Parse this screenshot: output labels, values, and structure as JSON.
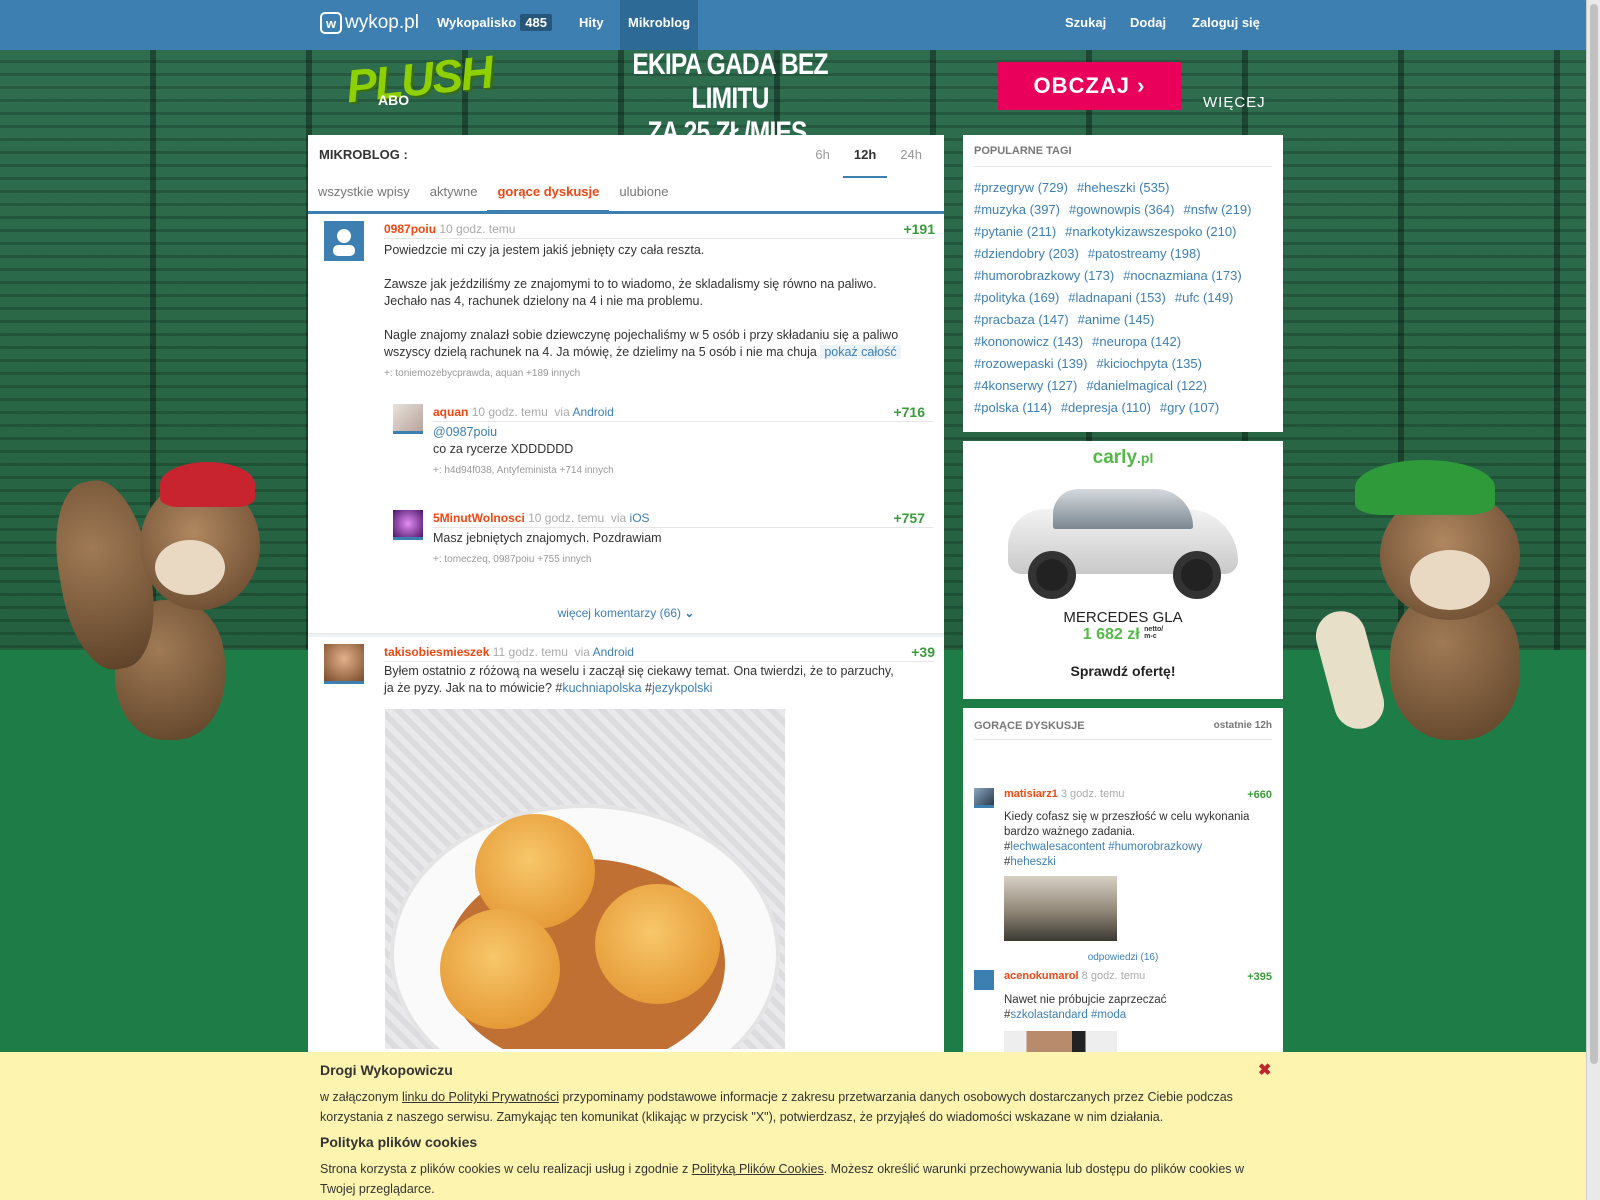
{
  "nav": {
    "logo": "wykop.pl",
    "logo_mark": "w",
    "items": [
      {
        "label": "Wykopalisko",
        "badge": "485"
      },
      {
        "label": "Hity"
      },
      {
        "label": "Mikroblog"
      }
    ],
    "right": [
      "Szukaj",
      "Dodaj",
      "Zaloguj się"
    ]
  },
  "ad": {
    "brand": "PLUSH",
    "brand_sub": "ABO",
    "headline": "EKIPA GADA BEZ LIMITU\nZA 25 ZŁ/MIES.",
    "button": "OBCZAJ  ›",
    "more": "WIĘCEJ"
  },
  "mikroblog": {
    "title": "MIKROBLOG :",
    "periods": [
      "6h",
      "12h",
      "24h"
    ],
    "tabs": [
      "wszystkie wpisy",
      "aktywne",
      "gorące dyskusje",
      "ulubione"
    ]
  },
  "entries": [
    {
      "user": "0987poiu",
      "time": "10 godz. temu",
      "score": "+191",
      "lines": [
        "Powiedzcie mi czy ja jestem jakiś jebnięty czy cała reszta.",
        "Zawsze jak jeździliśmy ze znajomymi to to wiadomo, że skladalismy się równo na paliwo.",
        "Jechało nas 4, rachunek dzielony na 4 i nie ma problemu.",
        "Nagle znajomy znalazł sobie dziewczynę pojechaliśmy w 5 osób i przy składaniu się a paliwo",
        "wszyscy dzielą rachunek na 4. Ja mówię, że dzielimy na 5 osób i nie ma chuja"
      ],
      "show_all": "pokaż całość",
      "plus": "+: toniemozebycprawda, aquan +189 innych"
    }
  ],
  "comments": [
    {
      "user": "aquan",
      "time": "10 godz. temu",
      "via_label": "via",
      "via": "Android",
      "score": "+716",
      "mention": "@0987poiu",
      "text": "co za rycerze XDDDDDD",
      "plus": "+: h4d94f038, Antyfeminista +714 innych"
    },
    {
      "user": "5MinutWolnosci",
      "time": "10 godz. temu",
      "via_label": "via",
      "via": "iOS",
      "score": "+757",
      "text": "Masz jebniętych znajomych. Pozdrawiam",
      "plus": "+: tomeczeq, 0987poiu +755 innych"
    }
  ],
  "more_comments": "więcej komentarzy (66)",
  "entry2": {
    "user": "takisobiesmieszek",
    "time": "11 godz. temu",
    "via_label": "via",
    "via": "Android",
    "score": "+39",
    "line1": "Byłem ostatnio z różową na weselu i zaczął się ciekawy temat. Ona twierdzi, że to parzuchy,",
    "line2_a": "ja że pyzy. Jak na to mówicie? #",
    "tag1": "kuchniapolska",
    "hash": "#",
    "tag2": "jezykpolski"
  },
  "popular_tags": {
    "title": "POPULARNE TAGI",
    "tags": [
      "#przegryw (729)",
      "#heheszki (535)",
      "#muzyka (397)",
      "#gownowpis (364)",
      "#nsfw (219)",
      "#pytanie (211)",
      "#narkotykizawszespoko (210)",
      "#dziendobry (203)",
      "#patostreamy (198)",
      "#humorobrazkowy (173)",
      "#nocnazmiana (173)",
      "#polityka (169)",
      "#ladnapani (153)",
      "#ufc (149)",
      "#pracbaza (147)",
      "#anime (145)",
      "#kononowicz (143)",
      "#neuropa (142)",
      "#rozowepaski (139)",
      "#kiciochpyta (135)",
      "#4konserwy (127)",
      "#danielmagical (122)",
      "#polska (114)",
      "#depresja (110)",
      "#gry (107)"
    ]
  },
  "carly": {
    "brand": "carly",
    "brand_tld": ".pl",
    "model": "MERCEDES GLA",
    "price": "1 682 zł",
    "price_unit_top": "netto/",
    "price_unit_bottom": "m-c",
    "cta": "Sprawdź ofertę!"
  },
  "hot": {
    "title": "GORĄCE DYSKUSJE",
    "range": "ostatnie 12h",
    "items": [
      {
        "user": "matisiarz1",
        "time": "3 godz. temu",
        "score": "+660",
        "text1": "Kiedy cofasz się w przeszłość w celu wykonania",
        "text2": "bardzo ważnego zadania.",
        "tags_a": "#",
        "tag1": "lechwalesacontent",
        "tag2": "#humorobrazkowy",
        "tag3_hash": "#",
        "tag3": "heheszki",
        "replies": "odpowiedzi (16)"
      },
      {
        "user": "acenokumarol",
        "time": "8 godz. temu",
        "score": "+395",
        "text1": "Nawet nie próbujcie zaprzeczać",
        "hash": "#",
        "tag1": "szkolastandard",
        "tag2": "#moda"
      }
    ]
  },
  "cookie": {
    "title1": "Drogi Wykopowiczu",
    "p1_a": "w załączonym ",
    "p1_link": "linku do Polityki Prywatności",
    "p1_b": " przypominamy podstawowe informacje z zakresu przetwarzania danych osobowych dostarczanych przez Ciebie podczas korzystania z naszego serwisu. Zamykając ten komunikat (klikając w przycisk \"X\"), potwierdzasz, że przyjąłeś do wiadomości wskazane w nim działania.",
    "title2": "Polityka plików cookies",
    "p2_a": "Strona korzysta z plików cookies w celu realizacji usług i zgodnie z ",
    "p2_link": "Polityką Plików Cookies",
    "p2_b": ". Możesz określić warunki przechowywania lub dostępu do plików cookies w Twojej przeglądarce.",
    "close": "✖"
  },
  "colors": {
    "nav": "#3e7fb2",
    "username": "#ee4814",
    "score": "#3c9a3c",
    "link": "#3e7fb2",
    "cookie_bg": "#fdf4b0",
    "ad_button": "#e8005a"
  }
}
